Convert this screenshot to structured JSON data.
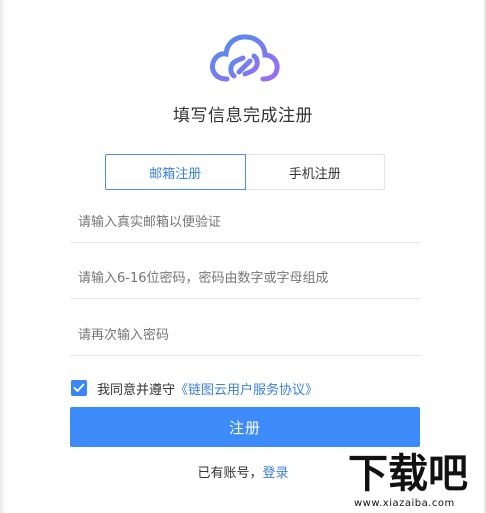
{
  "header": {
    "title": "填写信息完成注册"
  },
  "tabs": [
    {
      "label": "邮箱注册",
      "active": true
    },
    {
      "label": "手机注册",
      "active": false
    }
  ],
  "form": {
    "email_placeholder": "请输入真实邮箱以便验证",
    "password_placeholder": "请输入6-16位密码，密码由数字或字母组成",
    "confirm_placeholder": "请再次输入密码",
    "agree_text": "我同意并遵守",
    "agree_link": "《链图云用户服务协议》",
    "agree_checked": true,
    "submit_label": "注册"
  },
  "footer": {
    "have_account": "已有账号，",
    "login_link": "登录"
  },
  "watermark": {
    "text": "下载吧",
    "url": "www.xiazaiba.com"
  },
  "colors": {
    "accent": "#3d8bf8",
    "logo_gradient_start": "#4f8ff0",
    "logo_gradient_end": "#9b6cf0"
  },
  "icons": {
    "logo": "cloud-link-icon",
    "checkbox": "checkmark-icon"
  }
}
